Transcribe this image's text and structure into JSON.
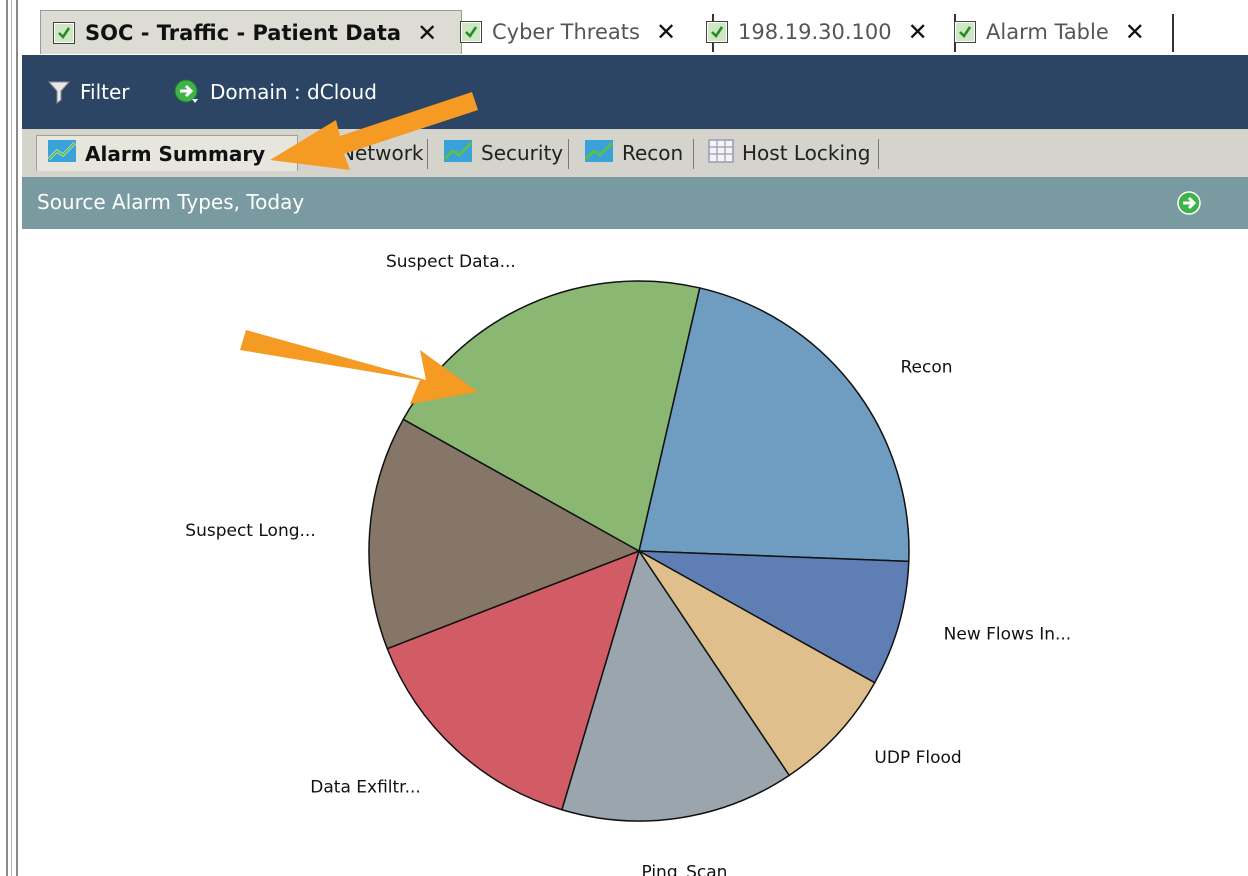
{
  "doc_tabs": [
    {
      "label": "SOC - Traffic - Patient Data",
      "active": true
    },
    {
      "label": "Cyber Threats",
      "active": false
    },
    {
      "label": "198.19.30.100",
      "active": false
    },
    {
      "label": "Alarm Table",
      "active": false
    }
  ],
  "toolbar": {
    "filter_label": "Filter",
    "filter_icon": "filter-icon",
    "domain_label": "Domain : dCloud",
    "domain_icon": "go-arrow-icon"
  },
  "sub_tabs": [
    {
      "label": "Alarm Summary",
      "icon": "line-chart-icon",
      "active": true
    },
    {
      "label": "Network",
      "icon": "line-chart-icon",
      "active": false
    },
    {
      "label": "Security",
      "icon": "line-chart-icon",
      "active": false
    },
    {
      "label": "Recon",
      "icon": "line-chart-icon",
      "active": false
    },
    {
      "label": "Host Locking",
      "icon": "table-icon",
      "active": false
    }
  ],
  "panel": {
    "title": "Source Alarm Types, Today",
    "go_icon": "go-arrow-icon"
  },
  "colors": {
    "toolbar_bg": "#2d4565",
    "panel_header_bg": "#7a9aa2",
    "annotation_arrow": "#f59a23"
  },
  "chart_data": {
    "type": "pie",
    "title": "",
    "series": [
      {
        "label": "Recon",
        "value": 22,
        "color": "#6f9cc1"
      },
      {
        "label": "New Flows In...",
        "value": 7.5,
        "color": "#5f7fb4"
      },
      {
        "label": "UDP Flood",
        "value": 7.5,
        "color": "#dfc08c"
      },
      {
        "label": "Ping_Scan",
        "value": 14,
        "color": "#9ba5ae"
      },
      {
        "label": "Data Exfiltr...",
        "value": 14.5,
        "color": "#d25c66"
      },
      {
        "label": "Suspect Long...",
        "value": 14,
        "color": "#857667"
      },
      {
        "label": "Suspect Data...",
        "value": 20.5,
        "color": "#8ab872"
      }
    ]
  }
}
